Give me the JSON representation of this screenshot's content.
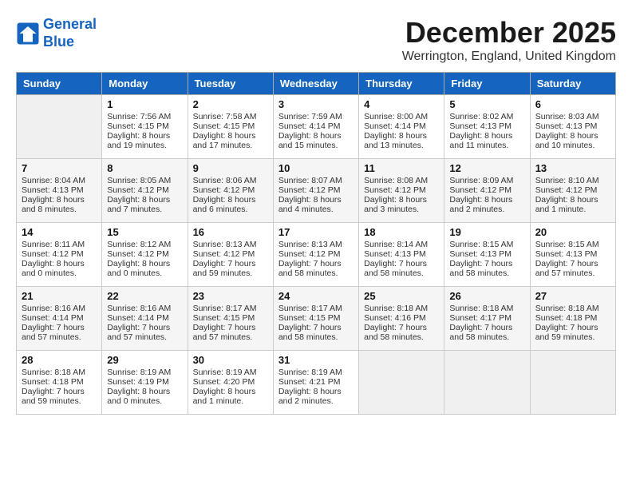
{
  "header": {
    "logo_line1": "General",
    "logo_line2": "Blue",
    "month_title": "December 2025",
    "location": "Werrington, England, United Kingdom"
  },
  "columns": [
    "Sunday",
    "Monday",
    "Tuesday",
    "Wednesday",
    "Thursday",
    "Friday",
    "Saturday"
  ],
  "weeks": [
    [
      {
        "num": "",
        "empty": true
      },
      {
        "num": "1",
        "sunrise": "7:56 AM",
        "sunset": "4:15 PM",
        "daylight": "8 hours and 19 minutes."
      },
      {
        "num": "2",
        "sunrise": "7:58 AM",
        "sunset": "4:15 PM",
        "daylight": "8 hours and 17 minutes."
      },
      {
        "num": "3",
        "sunrise": "7:59 AM",
        "sunset": "4:14 PM",
        "daylight": "8 hours and 15 minutes."
      },
      {
        "num": "4",
        "sunrise": "8:00 AM",
        "sunset": "4:14 PM",
        "daylight": "8 hours and 13 minutes."
      },
      {
        "num": "5",
        "sunrise": "8:02 AM",
        "sunset": "4:13 PM",
        "daylight": "8 hours and 11 minutes."
      },
      {
        "num": "6",
        "sunrise": "8:03 AM",
        "sunset": "4:13 PM",
        "daylight": "8 hours and 10 minutes."
      }
    ],
    [
      {
        "num": "7",
        "sunrise": "8:04 AM",
        "sunset": "4:13 PM",
        "daylight": "8 hours and 8 minutes."
      },
      {
        "num": "8",
        "sunrise": "8:05 AM",
        "sunset": "4:12 PM",
        "daylight": "8 hours and 7 minutes."
      },
      {
        "num": "9",
        "sunrise": "8:06 AM",
        "sunset": "4:12 PM",
        "daylight": "8 hours and 6 minutes."
      },
      {
        "num": "10",
        "sunrise": "8:07 AM",
        "sunset": "4:12 PM",
        "daylight": "8 hours and 4 minutes."
      },
      {
        "num": "11",
        "sunrise": "8:08 AM",
        "sunset": "4:12 PM",
        "daylight": "8 hours and 3 minutes."
      },
      {
        "num": "12",
        "sunrise": "8:09 AM",
        "sunset": "4:12 PM",
        "daylight": "8 hours and 2 minutes."
      },
      {
        "num": "13",
        "sunrise": "8:10 AM",
        "sunset": "4:12 PM",
        "daylight": "8 hours and 1 minute."
      }
    ],
    [
      {
        "num": "14",
        "sunrise": "8:11 AM",
        "sunset": "4:12 PM",
        "daylight": "8 hours and 0 minutes."
      },
      {
        "num": "15",
        "sunrise": "8:12 AM",
        "sunset": "4:12 PM",
        "daylight": "8 hours and 0 minutes."
      },
      {
        "num": "16",
        "sunrise": "8:13 AM",
        "sunset": "4:12 PM",
        "daylight": "7 hours and 59 minutes."
      },
      {
        "num": "17",
        "sunrise": "8:13 AM",
        "sunset": "4:12 PM",
        "daylight": "7 hours and 58 minutes."
      },
      {
        "num": "18",
        "sunrise": "8:14 AM",
        "sunset": "4:13 PM",
        "daylight": "7 hours and 58 minutes."
      },
      {
        "num": "19",
        "sunrise": "8:15 AM",
        "sunset": "4:13 PM",
        "daylight": "7 hours and 58 minutes."
      },
      {
        "num": "20",
        "sunrise": "8:15 AM",
        "sunset": "4:13 PM",
        "daylight": "7 hours and 57 minutes."
      }
    ],
    [
      {
        "num": "21",
        "sunrise": "8:16 AM",
        "sunset": "4:14 PM",
        "daylight": "7 hours and 57 minutes."
      },
      {
        "num": "22",
        "sunrise": "8:16 AM",
        "sunset": "4:14 PM",
        "daylight": "7 hours and 57 minutes."
      },
      {
        "num": "23",
        "sunrise": "8:17 AM",
        "sunset": "4:15 PM",
        "daylight": "7 hours and 57 minutes."
      },
      {
        "num": "24",
        "sunrise": "8:17 AM",
        "sunset": "4:15 PM",
        "daylight": "7 hours and 58 minutes."
      },
      {
        "num": "25",
        "sunrise": "8:18 AM",
        "sunset": "4:16 PM",
        "daylight": "7 hours and 58 minutes."
      },
      {
        "num": "26",
        "sunrise": "8:18 AM",
        "sunset": "4:17 PM",
        "daylight": "7 hours and 58 minutes."
      },
      {
        "num": "27",
        "sunrise": "8:18 AM",
        "sunset": "4:18 PM",
        "daylight": "7 hours and 59 minutes."
      }
    ],
    [
      {
        "num": "28",
        "sunrise": "8:18 AM",
        "sunset": "4:18 PM",
        "daylight": "7 hours and 59 minutes."
      },
      {
        "num": "29",
        "sunrise": "8:19 AM",
        "sunset": "4:19 PM",
        "daylight": "8 hours and 0 minutes."
      },
      {
        "num": "30",
        "sunrise": "8:19 AM",
        "sunset": "4:20 PM",
        "daylight": "8 hours and 1 minute."
      },
      {
        "num": "31",
        "sunrise": "8:19 AM",
        "sunset": "4:21 PM",
        "daylight": "8 hours and 2 minutes."
      },
      {
        "num": "",
        "empty": true
      },
      {
        "num": "",
        "empty": true
      },
      {
        "num": "",
        "empty": true
      }
    ]
  ]
}
